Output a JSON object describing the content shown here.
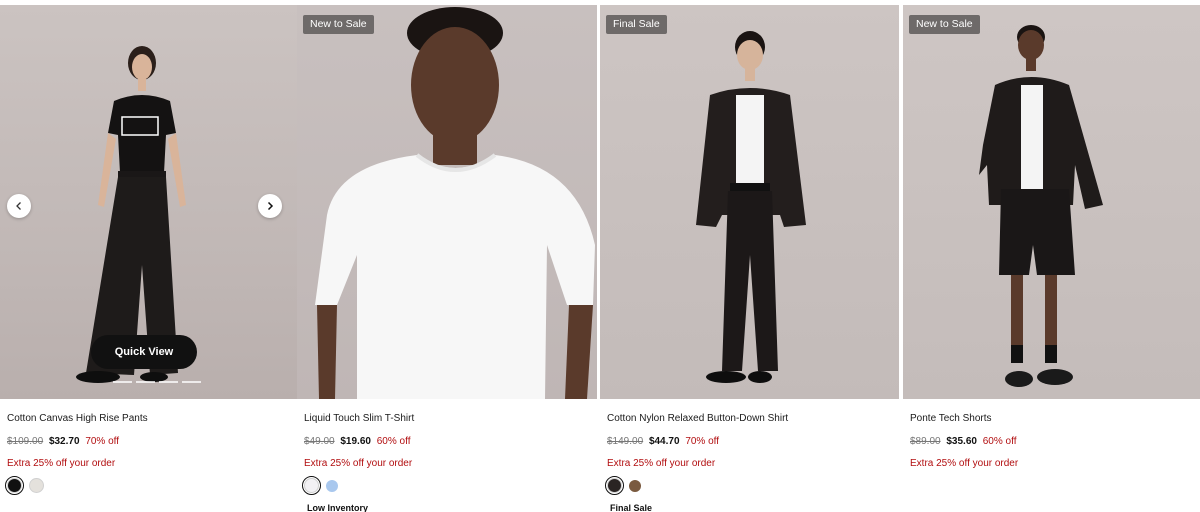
{
  "products": [
    {
      "badge": "",
      "name": "Cotton Canvas High Rise Pants",
      "original_price": "$109.00",
      "sale_price": "$32.70",
      "discount": "70% off",
      "promo": "Extra 25% off your order",
      "status": "",
      "quick_view": "Quick View",
      "swatches": [
        "#111111",
        "#e4e1dc"
      ]
    },
    {
      "badge": "New to Sale",
      "name": "Liquid Touch Slim T-Shirt",
      "original_price": "$49.00",
      "sale_price": "$19.60",
      "discount": "60% off",
      "promo": "Extra 25% off your order",
      "status": "Low Inventory",
      "swatches": [
        "#f2f1f4",
        "#a9c8ee"
      ]
    },
    {
      "badge": "Final Sale",
      "name": "Cotton Nylon Relaxed Button-Down Shirt",
      "original_price": "$149.00",
      "sale_price": "$44.70",
      "discount": "70% off",
      "promo": "Extra 25% off your order",
      "status": "Final Sale",
      "swatches": [
        "#2a2423",
        "#7a5a3f"
      ]
    },
    {
      "badge": "New to Sale",
      "name": "Ponte Tech Shorts",
      "original_price": "$89.00",
      "sale_price": "$35.60",
      "discount": "60% off",
      "promo": "Extra 25% off your order",
      "status": "",
      "swatches": []
    }
  ],
  "colors": {
    "sale_red": "#b20e10",
    "badge_gray": "#6e6a69",
    "button_black": "#111111"
  },
  "icons": {
    "prev": "chevron-left-icon",
    "next": "chevron-right-icon"
  }
}
